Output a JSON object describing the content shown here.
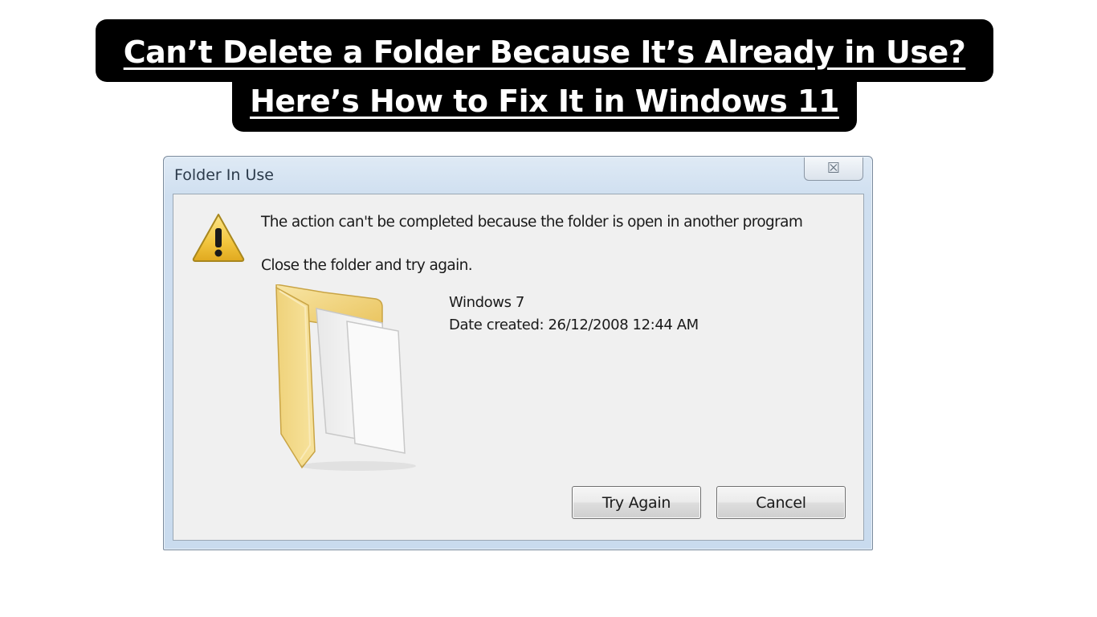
{
  "headline": {
    "line1": "Can’t Delete a Folder Because It’s Already in Use?",
    "line2": "Here’s How to Fix It in Windows 11"
  },
  "dialog": {
    "title": "Folder In Use",
    "close_glyph": "☒",
    "message": "The action can't be completed because the folder is open in another program",
    "instruction": "Close the folder and try again.",
    "item": {
      "name": "Windows 7",
      "date_created": "Date created: 26/12/2008 12:44 AM"
    },
    "buttons": {
      "try_again": "Try Again",
      "cancel": "Cancel"
    },
    "icons": {
      "warning": "warning-icon",
      "folder": "folder-icon",
      "close": "close-icon"
    }
  },
  "colors": {
    "banner_bg": "#000000",
    "banner_text": "#ffffff",
    "dialog_frame": "#c9dbee",
    "dialog_client": "#f0f0f0",
    "warning_yellow": "#f2c53d",
    "folder_yellow": "#f3d67a"
  }
}
